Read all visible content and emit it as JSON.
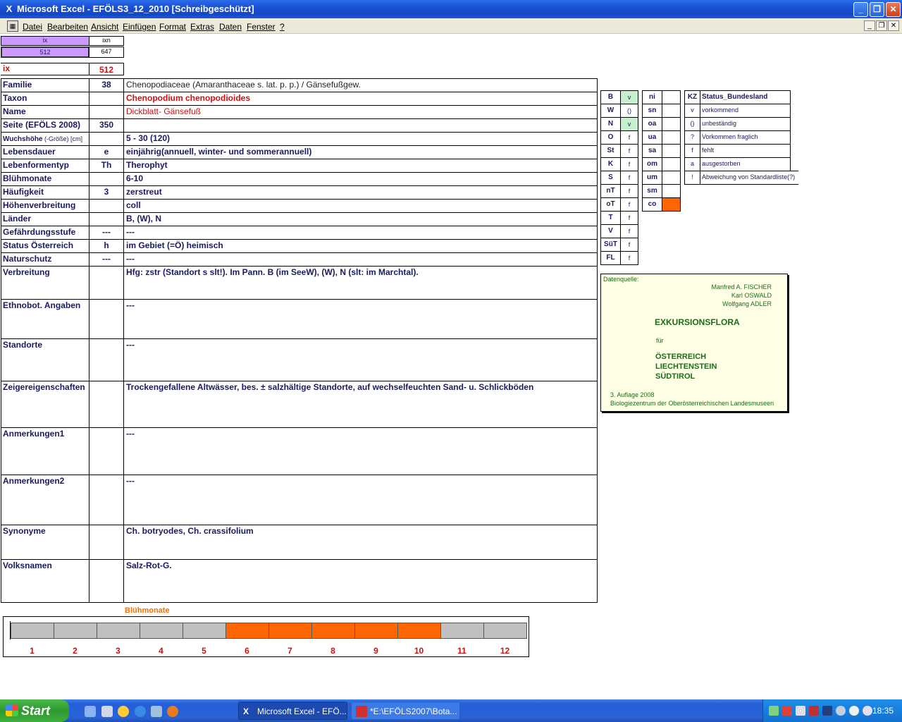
{
  "window": {
    "title": "Microsoft Excel - EFÖLS3_12_2010  [Schreibgeschützt]",
    "app_icon": "excel-icon",
    "accent": "#1547c4"
  },
  "menu": {
    "items": [
      "Datei",
      "Bearbeiten",
      "Ansicht",
      "Einfügen",
      "Format",
      "Extras",
      "Daten",
      "Fenster",
      "?"
    ]
  },
  "index": {
    "ix_label": "ix",
    "ixn_label": "ixn",
    "ix_value": "512",
    "ixn_value": "647",
    "ix_big_label": "ix",
    "ix_big_value": "512"
  },
  "fields": [
    {
      "label": "Familie",
      "code": "38",
      "value": "Chenopodiaceae (Amaranthaceae s. lat. p. p.)  /  Gänsefußgew."
    },
    {
      "label": "Taxon",
      "code": "",
      "value": "Chenopodium chenopodioides"
    },
    {
      "label": "Name",
      "code": "",
      "value": "Dickblatt- Gänsefuß"
    },
    {
      "label": "Seite (EFÖLS 2008)",
      "code": "350",
      "value": ""
    },
    {
      "label": "Wuchshöhe",
      "label_suffix": " (-Größe) [cm]",
      "code": "",
      "value": " 5 - 30 (120)"
    },
    {
      "label": "Lebensdauer",
      "code": "e",
      "value": "einjährig(annuell, winter- und sommerannuell)"
    },
    {
      "label": "Lebenformentyp",
      "code": "Th",
      "value": "Therophyt"
    },
    {
      "label": "Blühmonate",
      "code": "",
      "value": " 6-10"
    },
    {
      "label": "Häufigkeit",
      "code": "3",
      "value": "zerstreut"
    },
    {
      "label": "Höhenverbreitung",
      "code": "",
      "value": "coll"
    },
    {
      "label": "Länder",
      "code": "",
      "value": "B, (W), N"
    },
    {
      "label": "Gefährdungsstufe",
      "code": "---",
      "value": "   ---"
    },
    {
      "label": "Status Österreich",
      "code": "h",
      "value": "im Gebiet (=Ö) heimisch"
    },
    {
      "label": "Naturschutz",
      "code": "---",
      "value": " ---"
    }
  ],
  "long_fields": [
    {
      "label": "Verbreitung",
      "value": "Hfg: zstr (Standort s slt!). Im Pann. B (im SeeW), (W), N (slt: im Marchtal)."
    },
    {
      "label": "Ethnobot. Angaben",
      "value": "---"
    },
    {
      "label": "Standorte",
      "value": "---"
    },
    {
      "label": "Zeigereigenschaften",
      "value": "Trockengefallene Altwässer, bes. ± salzhältige Standorte, auf wechselfeuchten Sand- u. Schlickböden"
    },
    {
      "label": "Anmerkungen1",
      "value": "---"
    },
    {
      "label": "Anmerkungen2",
      "value": "---"
    },
    {
      "label": "Synonyme",
      "value": "Ch. botryodes, Ch. crassifolium"
    },
    {
      "label": "Volksnamen",
      "value": "Salz-Rot-G."
    }
  ],
  "regions": [
    {
      "code": "B",
      "status": "v",
      "highlight": true
    },
    {
      "code": "W",
      "status": "()",
      "highlight": false
    },
    {
      "code": "N",
      "status": "v",
      "highlight": true
    },
    {
      "code": "O",
      "status": "f",
      "highlight": false
    },
    {
      "code": "St",
      "status": "f",
      "highlight": false
    },
    {
      "code": "K",
      "status": "f",
      "highlight": false
    },
    {
      "code": "S",
      "status": "f",
      "highlight": false
    },
    {
      "code": "nT",
      "status": "f",
      "highlight": false
    },
    {
      "code": "oT",
      "status": "f",
      "highlight": false
    },
    {
      "code": "T",
      "status": "f",
      "highlight": false
    },
    {
      "code": "V",
      "status": "f",
      "highlight": false
    },
    {
      "code": "SüT",
      "status": "f",
      "highlight": false
    },
    {
      "code": "FL",
      "status": "f",
      "highlight": false
    }
  ],
  "altitudes": [
    {
      "code": "ni",
      "active": false
    },
    {
      "code": "sn",
      "active": false
    },
    {
      "code": "oa",
      "active": false
    },
    {
      "code": "ua",
      "active": false
    },
    {
      "code": "sa",
      "active": false
    },
    {
      "code": "om",
      "active": false
    },
    {
      "code": "um",
      "active": false
    },
    {
      "code": "sm",
      "active": false
    },
    {
      "code": "co",
      "active": true
    }
  ],
  "status_legend": {
    "header_kz": "KZ",
    "header_status": "Status_Bundesland",
    "rows": [
      {
        "kz": "v",
        "text": "vorkommend"
      },
      {
        "kz": "()",
        "text": "unbeständig"
      },
      {
        "kz": "?",
        "text": "Vorkommen fraglich"
      },
      {
        "kz": "f",
        "text": "fehlt"
      },
      {
        "kz": "a",
        "text": "ausgestorben"
      },
      {
        "kz": "!",
        "text": "Abweichung von Standardliste(?)"
      }
    ]
  },
  "datenquelle": {
    "label": "Datenquelle:",
    "authors": [
      "Manfred A. FISCHER",
      "Karl OSWALD",
      "Wolfgang ADLER"
    ],
    "title": "EXKURSIONSFLORA",
    "fuer": "für",
    "countries": [
      "ÖSTERREICH",
      "LIECHTENSTEIN",
      "SÜDTIROL"
    ],
    "edition": "3. Auflage 2008",
    "publisher": "Biologiezentrum der Oberösterreichischen Landesmuseen"
  },
  "bloom": {
    "title": "Blühmonate",
    "months": [
      "1",
      "2",
      "3",
      "4",
      "5",
      "6",
      "7",
      "8",
      "9",
      "10",
      "11",
      "12"
    ],
    "flowering": [
      false,
      false,
      false,
      false,
      false,
      true,
      true,
      true,
      true,
      true,
      false,
      false
    ],
    "color_on": "#ff6600",
    "color_off": "#c0c0c0"
  },
  "taskbar": {
    "start_label": "Start",
    "tasks": [
      "Microsoft Excel - EFÖ...",
      "*E:\\EFÖLS2007\\Bota..."
    ],
    "clock": "18:35"
  }
}
